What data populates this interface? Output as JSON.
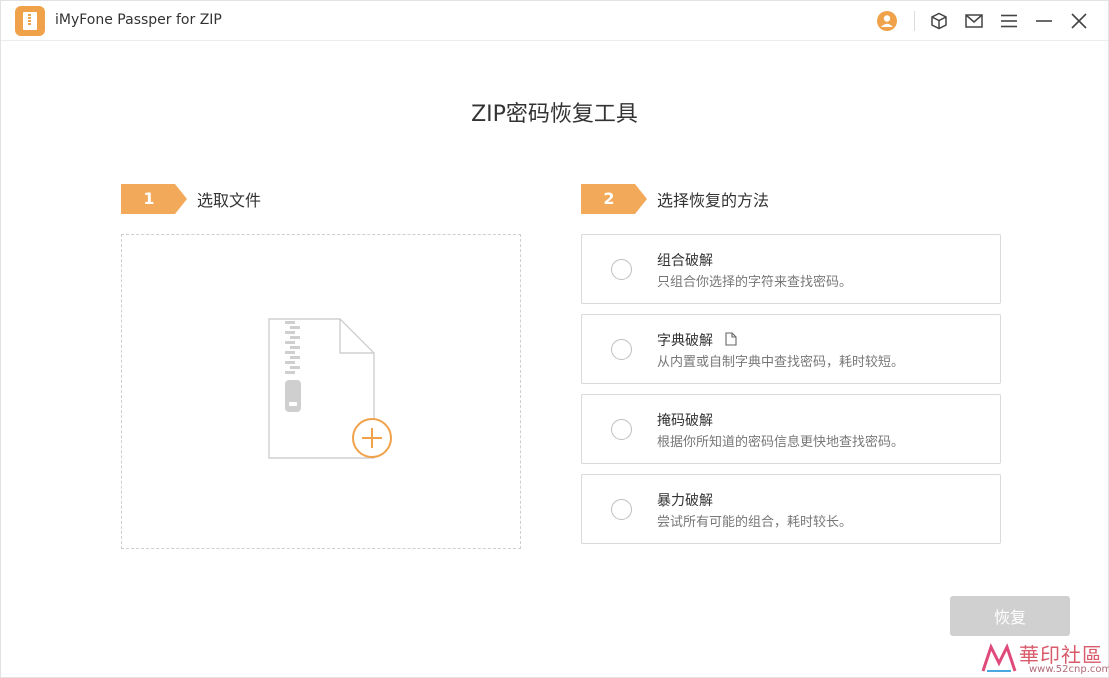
{
  "titlebar": {
    "app_name": "iMyFone Passper for ZIP",
    "icons": [
      "user-icon",
      "box-icon",
      "mail-icon",
      "menu-icon",
      "minimize-icon",
      "close-icon"
    ],
    "accent_color": "#f0a24a"
  },
  "page": {
    "title": "ZIP密码恢复工具"
  },
  "steps": [
    {
      "number": "1",
      "label": "选取文件"
    },
    {
      "number": "2",
      "label": "选择恢复的方法"
    }
  ],
  "methods": [
    {
      "title": "组合破解",
      "desc": "只组合你选择的字符来查找密码。",
      "selected": false
    },
    {
      "title": "字典破解",
      "desc": "从内置或自制字典中查找密码，耗时较短。",
      "selected": false,
      "icon": "document-icon"
    },
    {
      "title": "掩码破解",
      "desc": "根据你所知道的密码信息更快地查找密码。",
      "selected": false
    },
    {
      "title": "暴力破解",
      "desc": "尝试所有可能的组合，耗时较长。",
      "selected": false
    }
  ],
  "actions": {
    "recover_label": "恢复"
  },
  "watermark": {
    "text": "華印社區",
    "url": "www.52cnp.com"
  }
}
